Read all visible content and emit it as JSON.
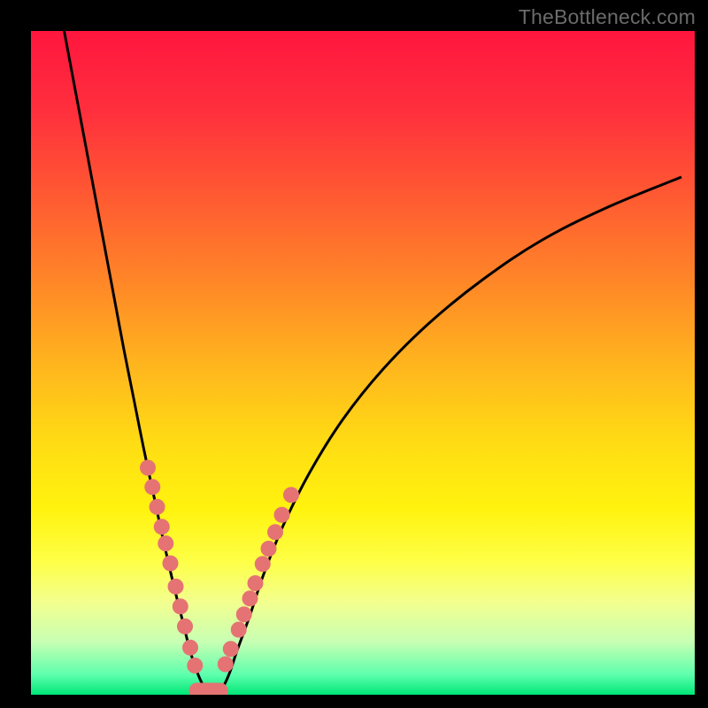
{
  "watermark": "TheBottleneck.com",
  "colors": {
    "page_bg": "#000000",
    "gradient_stops": [
      {
        "offset": 0.0,
        "color": "#ff163e"
      },
      {
        "offset": 0.12,
        "color": "#ff2f3d"
      },
      {
        "offset": 0.25,
        "color": "#ff5a32"
      },
      {
        "offset": 0.38,
        "color": "#ff8727"
      },
      {
        "offset": 0.5,
        "color": "#ffb41e"
      },
      {
        "offset": 0.62,
        "color": "#ffdc14"
      },
      {
        "offset": 0.72,
        "color": "#fff30e"
      },
      {
        "offset": 0.8,
        "color": "#feff47"
      },
      {
        "offset": 0.86,
        "color": "#f3ff8e"
      },
      {
        "offset": 0.92,
        "color": "#c8ffb3"
      },
      {
        "offset": 0.97,
        "color": "#5dffad"
      },
      {
        "offset": 1.0,
        "color": "#00e676"
      }
    ],
    "curve_stroke": "#000000",
    "marker_fill": "#e57373",
    "marker_stroke": "#c85a5a"
  },
  "chart_data": {
    "type": "line",
    "title": "",
    "xlabel": "",
    "ylabel": "",
    "xlim": [
      0,
      100
    ],
    "ylim": [
      0,
      100
    ],
    "grid": false,
    "legend": false,
    "annotations": [
      "TheBottleneck.com"
    ],
    "series": [
      {
        "name": "bottleneck-curve",
        "x": [
          5.0,
          6.5,
          8.0,
          9.5,
          11.0,
          12.5,
          14.0,
          15.5,
          17.0,
          18.5,
          20.0,
          21.5,
          23.0,
          24.0,
          25.0,
          26.0,
          27.0,
          28.0,
          29.0,
          30.0,
          31.0,
          33.0,
          35.0,
          38.0,
          42.0,
          47.0,
          53.0,
          60.0,
          68.0,
          77.0,
          87.0,
          98.0
        ],
        "y": [
          100,
          92,
          84,
          76,
          68,
          60,
          52,
          44.5,
          37,
          30,
          23,
          16.5,
          10.5,
          6.5,
          3.5,
          1.3,
          0.3,
          0.3,
          1.3,
          3.5,
          6.5,
          12,
          18,
          25.5,
          33.5,
          41.5,
          49,
          56,
          62.5,
          68.5,
          73.5,
          78
        ]
      }
    ],
    "markers_left": {
      "x": [
        17.6,
        18.3,
        19.0,
        19.7,
        20.3,
        21.0,
        21.8,
        22.5,
        23.2,
        24.0,
        24.7
      ],
      "y": [
        34.2,
        31.3,
        28.3,
        25.3,
        22.8,
        19.8,
        16.3,
        13.3,
        10.3,
        7.1,
        4.4
      ]
    },
    "markers_right": {
      "x": [
        29.3,
        30.1,
        31.3,
        32.1,
        33.0,
        33.8,
        34.9,
        35.8,
        36.8,
        37.8,
        39.2
      ],
      "y": [
        4.6,
        6.9,
        9.8,
        12.1,
        14.5,
        16.8,
        19.7,
        22.0,
        24.5,
        27.1,
        30.1
      ]
    },
    "baseline_cap": {
      "x": [
        25.0,
        28.5
      ],
      "y": [
        0.6,
        0.6
      ]
    },
    "optimum_x": 27.0
  }
}
